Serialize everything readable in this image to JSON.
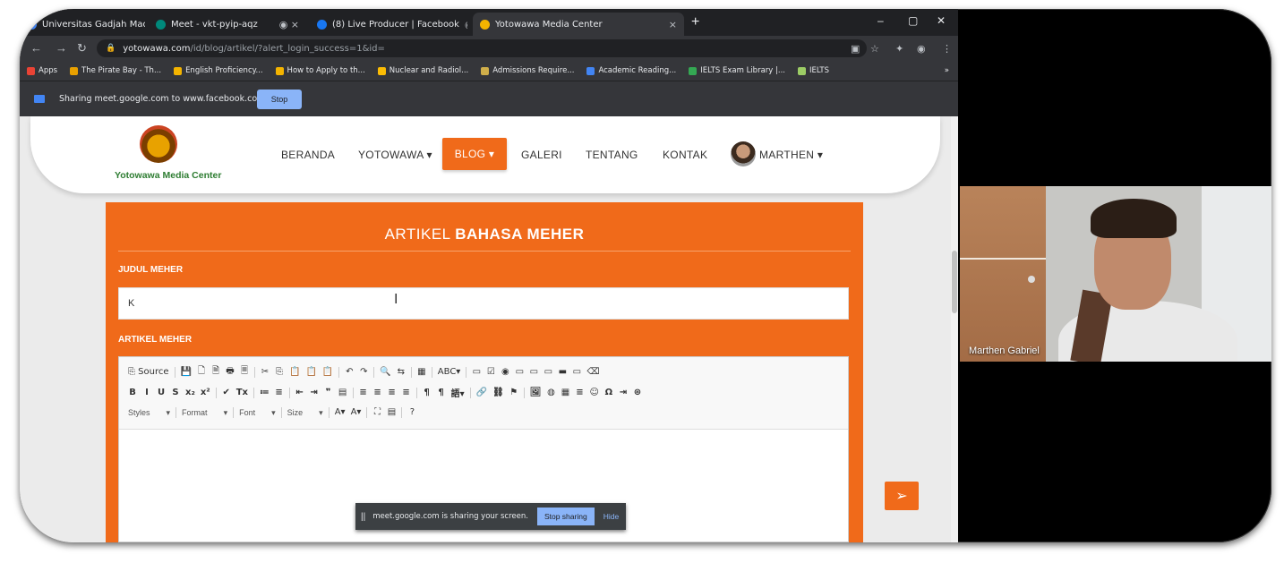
{
  "browser": {
    "tabs": [
      {
        "label": "Universitas Gadjah Mada - Calen",
        "favicon_color": "#4285f4"
      },
      {
        "label": "Meet - vkt-pyip-aqz",
        "favicon_color": "#00897b"
      },
      {
        "label": "(8) Live Producer | Facebook",
        "favicon_color": "#1877f2"
      },
      {
        "label": "Yotowawa Media Center",
        "favicon_color": "#f4b400"
      }
    ],
    "new_tab": "+",
    "url_host": "yotowawa.com",
    "url_path": "/id/blog/artikel/?alert_login_success=1&id=",
    "bookmarks": [
      {
        "label": "Apps",
        "color": "#ea4335"
      },
      {
        "label": "The Pirate Bay - Th...",
        "color": "#e8a000"
      },
      {
        "label": "English Proficiency...",
        "color": "#f4b400"
      },
      {
        "label": "How to Apply to th...",
        "color": "#f4b400"
      },
      {
        "label": "Nuclear and Radiol...",
        "color": "#fbbc04"
      },
      {
        "label": "Admissions Require...",
        "color": "#cfae4a"
      },
      {
        "label": "Academic Reading...",
        "color": "#4285f4"
      },
      {
        "label": "IELTS Exam Library |...",
        "color": "#34a853"
      },
      {
        "label": "IELTS",
        "color": "#9ccc65"
      }
    ],
    "sharing_message": "Sharing meet.google.com to www.facebook.com",
    "sharing_stop": "Stop"
  },
  "site": {
    "logo_text": "Yotowawa Media Center",
    "nav": {
      "beranda": "BERANDA",
      "yotowawa": "YOTOWAWA ▾",
      "blog": "BLOG ▾",
      "galeri": "GALERI",
      "tentang": "TENTANG",
      "kontak": "KONTAK",
      "user": "MARTHEN ▾"
    },
    "form": {
      "title_prefix": "ARTIKEL ",
      "title_bold": "BAHASA MEHER",
      "judul_label": "JUDUL MEHER",
      "judul_value": "K",
      "artikel_label": "ARTIKEL MEHER",
      "toolbar_row1": [
        "⎘ Source",
        "|",
        "💾",
        "🗋",
        "🗎",
        "🖶",
        "🗏",
        "|",
        "✂",
        "⎘",
        "📋",
        "📋",
        "📋",
        "|",
        "↶",
        "↷",
        "|",
        "🔍",
        "⇆",
        "|",
        "▦",
        "|",
        "ABC▾",
        "|",
        "▭",
        "☑",
        "◉",
        "▭",
        "▭",
        "▭",
        "▬",
        "▭",
        "⌫"
      ],
      "toolbar_row2": [
        "B",
        "I",
        "U",
        "S",
        "x₂",
        "x²",
        "|",
        "✔",
        "Tx",
        "|",
        "≔",
        "≡",
        "|",
        "⇤",
        "⇥",
        "❞",
        "▤",
        "|",
        "≡",
        "≡",
        "≡",
        "≡",
        "|",
        "¶",
        "¶",
        "語▾",
        "|",
        "🔗",
        "⛓",
        "⚑",
        "|",
        "🖼",
        "◍",
        "▦",
        "≡",
        "☺",
        "Ω",
        "⇥",
        "⊛"
      ],
      "toolbar_row3": {
        "styles": "Styles",
        "format": "Format",
        "font": "Font",
        "size": "Size",
        "extra": [
          "A▾",
          "A▾",
          "|",
          "⛶",
          "▤",
          "|",
          "?"
        ]
      }
    }
  },
  "meet_share": {
    "message": "meet.google.com is sharing your screen.",
    "stop": "Stop sharing",
    "hide": "Hide"
  },
  "video": {
    "participant_name": "Marthen Gabriel"
  },
  "colors": {
    "accent": "#f06a1a",
    "chrome_dark": "#202124",
    "chrome_bar": "#35363a",
    "meet_blue": "#8ab4f8"
  },
  "icons": {
    "send": "paper-plane-icon",
    "lock": "lock-icon",
    "reload": "reload-icon"
  }
}
